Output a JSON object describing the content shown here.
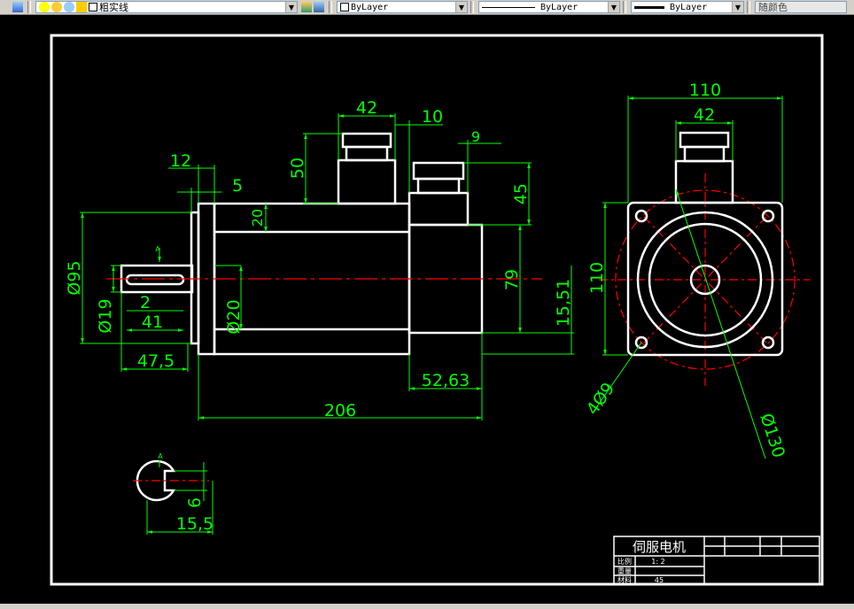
{
  "toolbar": {
    "layer_name": "粗实线",
    "color": "ByLayer",
    "linetype": "ByLayer",
    "lineweight": "ByLayer",
    "plot_style": "随颜色"
  },
  "drawing": {
    "dimensions": {
      "d110_top": "110",
      "d42_right": "42",
      "d42_side": "42",
      "d10": "10",
      "d9": "9",
      "d12": "12",
      "d5": "5",
      "d50": "50",
      "d45": "45",
      "d20_upper": "20",
      "d95": "Ø95",
      "d19": "Ø19",
      "d2": "2",
      "d41": "41",
      "d20_lower": "Ø20",
      "d475": "47,5",
      "d79": "79",
      "d1551": "15,51",
      "d5263": "52,63",
      "d206": "206",
      "d110_side": "110",
      "d4x9": "4Ø9",
      "d130": "Ø130",
      "d6": "6",
      "d155": "15,5",
      "sectionA": "A",
      "arrowA": "A"
    },
    "title_block": {
      "name": "伺服电机",
      "scale_label": "比例",
      "scale_value": "1: 2",
      "weight_label": "重量",
      "material_label": "材料",
      "material_value": "45"
    },
    "colors": {
      "object": "#ffffff",
      "dimension": "#00ff00",
      "center": "#ff0000",
      "background": "#000000"
    }
  }
}
